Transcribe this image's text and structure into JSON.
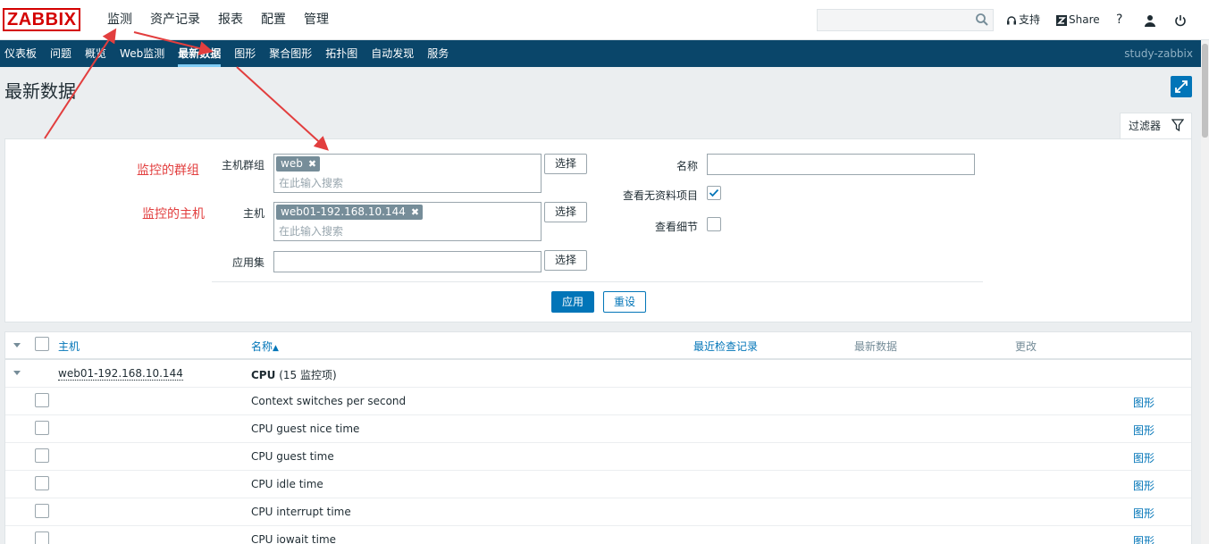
{
  "logo": "ZABBIX",
  "main_menu": [
    "监测",
    "资产记录",
    "报表",
    "配置",
    "管理"
  ],
  "top_right": {
    "support": "支持",
    "share": "Share",
    "help": "?"
  },
  "sub_menu": [
    "仪表板",
    "问题",
    "概览",
    "Web监测",
    "最新数据",
    "图形",
    "聚合图形",
    "拓扑图",
    "自动发现",
    "服务"
  ],
  "server_name": "study-zabbix",
  "page_title": "最新数据",
  "filter": {
    "tab_label": "过滤器",
    "host_groups_label": "主机群组",
    "host_groups_tag": "web",
    "hosts_label": "主机",
    "hosts_tag": "web01-192.168.10.144",
    "search_placeholder": "在此输入搜索",
    "select_label": "选择",
    "application_label": "应用集",
    "name_label": "名称",
    "show_without_data_label": "查看无资料项目",
    "show_without_data": true,
    "show_details_label": "查看细节",
    "show_details": false,
    "apply_label": "应用",
    "reset_label": "重设"
  },
  "annotations": {
    "group": "监控的群组",
    "host": "监控的主机"
  },
  "table": {
    "headers": {
      "host": "主机",
      "name": "名称",
      "last_check": "最近检查记录",
      "last_value": "最新数据",
      "change": "更改"
    },
    "sort_indicator": "▲",
    "host_row": {
      "host": "web01-192.168.10.144",
      "application": "CPU",
      "count_text": "(15 监控项)"
    },
    "graph_link": "图形",
    "items": [
      "Context switches per second",
      "CPU guest nice time",
      "CPU guest time",
      "CPU idle time",
      "CPU interrupt time",
      "CPU iowait time"
    ]
  },
  "colors": {
    "brand_red": "#d40000",
    "nav_blue": "#0a466a",
    "link_blue": "#0275b8",
    "annotation_red": "#e23e3e"
  }
}
